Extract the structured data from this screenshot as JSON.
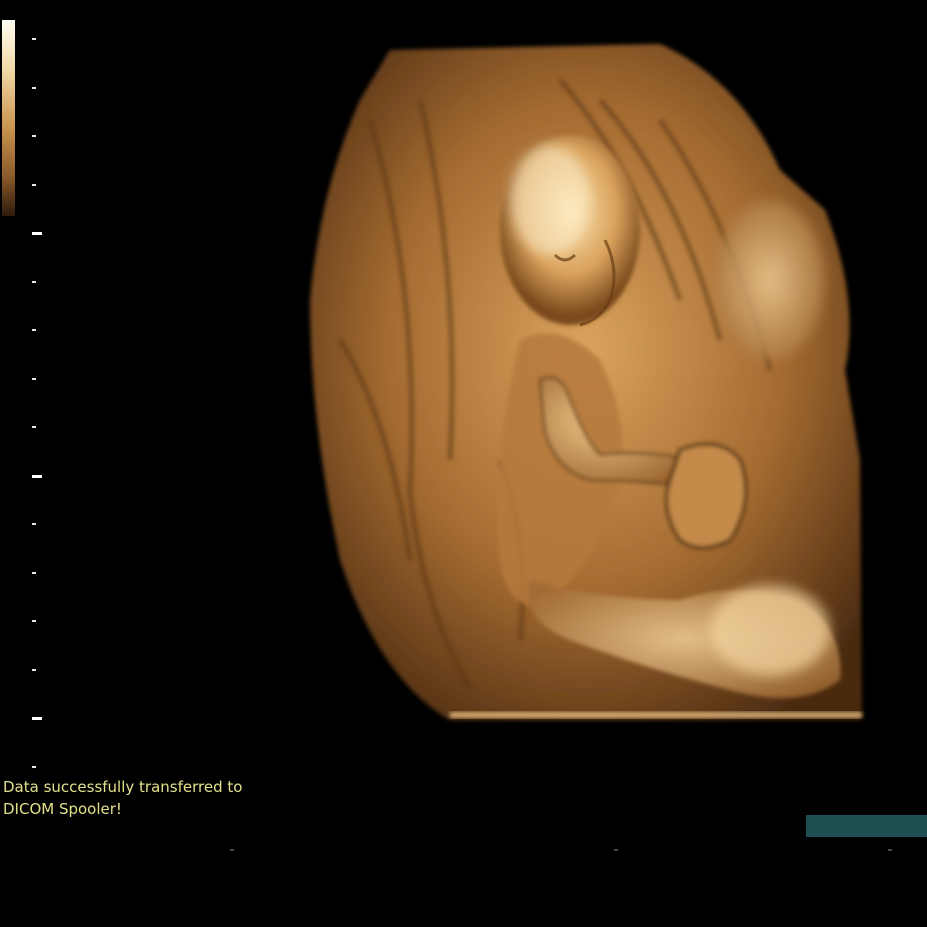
{
  "status": {
    "message": "Data successfully transferred to\nDICOM Spooler!"
  },
  "colors": {
    "background": "#000000",
    "status_text": "#e3e08a",
    "transfer_bar": "#1d4f53",
    "render_base": "#8c5a28",
    "render_highlight": "#f2cf8e"
  },
  "icons": {
    "colorbar": "grayscale-map-icon"
  }
}
